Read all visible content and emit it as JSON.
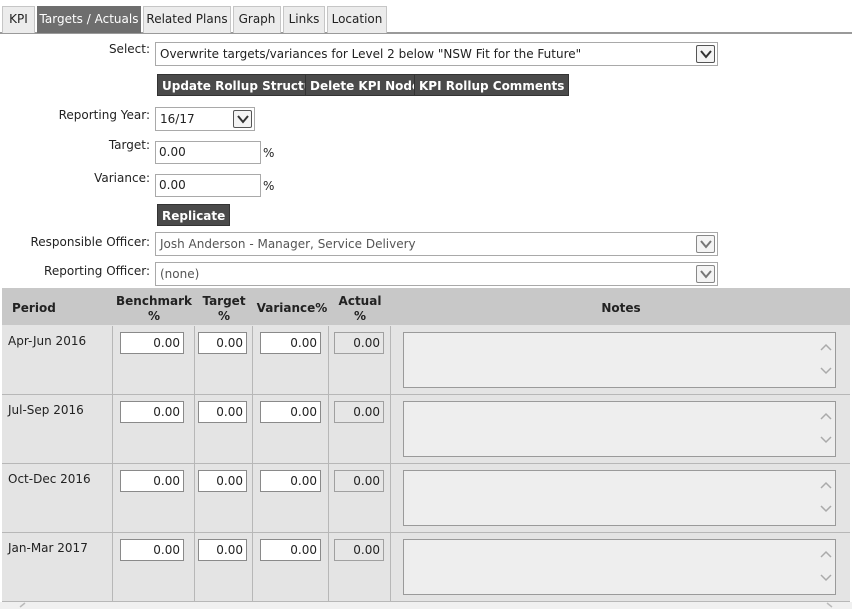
{
  "tabs": [
    {
      "label": "KPI",
      "active": false
    },
    {
      "label": "Targets / Actuals",
      "active": true
    },
    {
      "label": "Related Plans",
      "active": false
    },
    {
      "label": "Graph",
      "active": false
    },
    {
      "label": "Links",
      "active": false
    },
    {
      "label": "Location",
      "active": false
    }
  ],
  "form": {
    "select_label": "Select:",
    "select_value": "Overwrite targets/variances for Level 2 below \"NSW Fit for the Future\"",
    "buttons": {
      "update_rollup": "Update Rollup Structure",
      "delete_nodes": "Delete KPI Nodes",
      "rollup_comments": "KPI Rollup Comments",
      "replicate": "Replicate"
    },
    "reporting_year_label": "Reporting Year:",
    "reporting_year_value": "16/17",
    "target_label": "Target:",
    "target_value": "0.00",
    "target_unit": "%",
    "variance_label": "Variance:",
    "variance_value": "0.00",
    "variance_unit": "%",
    "responsible_officer_label": "Responsible Officer:",
    "responsible_officer_value": "Josh Anderson - Manager, Service Delivery",
    "reporting_officer_label": "Reporting Officer:",
    "reporting_officer_value": "(none)"
  },
  "grid": {
    "headers": {
      "period": "Period",
      "benchmark_1": "Benchmark",
      "benchmark_2": "%",
      "target_1": "Target",
      "target_2": "%",
      "variance": "Variance%",
      "actual_1": "Actual",
      "actual_2": "%",
      "notes": "Notes"
    },
    "rows": [
      {
        "period": "Apr-Jun 2016",
        "benchmark": "0.00",
        "target": "0.00",
        "variance": "0.00",
        "actual": "0.00"
      },
      {
        "period": "Jul-Sep 2016",
        "benchmark": "0.00",
        "target": "0.00",
        "variance": "0.00",
        "actual": "0.00"
      },
      {
        "period": "Oct-Dec 2016",
        "benchmark": "0.00",
        "target": "0.00",
        "variance": "0.00",
        "actual": "0.00"
      },
      {
        "period": "Jan-Mar 2017",
        "benchmark": "0.00",
        "target": "0.00",
        "variance": "0.00",
        "actual": "0.00"
      }
    ]
  }
}
